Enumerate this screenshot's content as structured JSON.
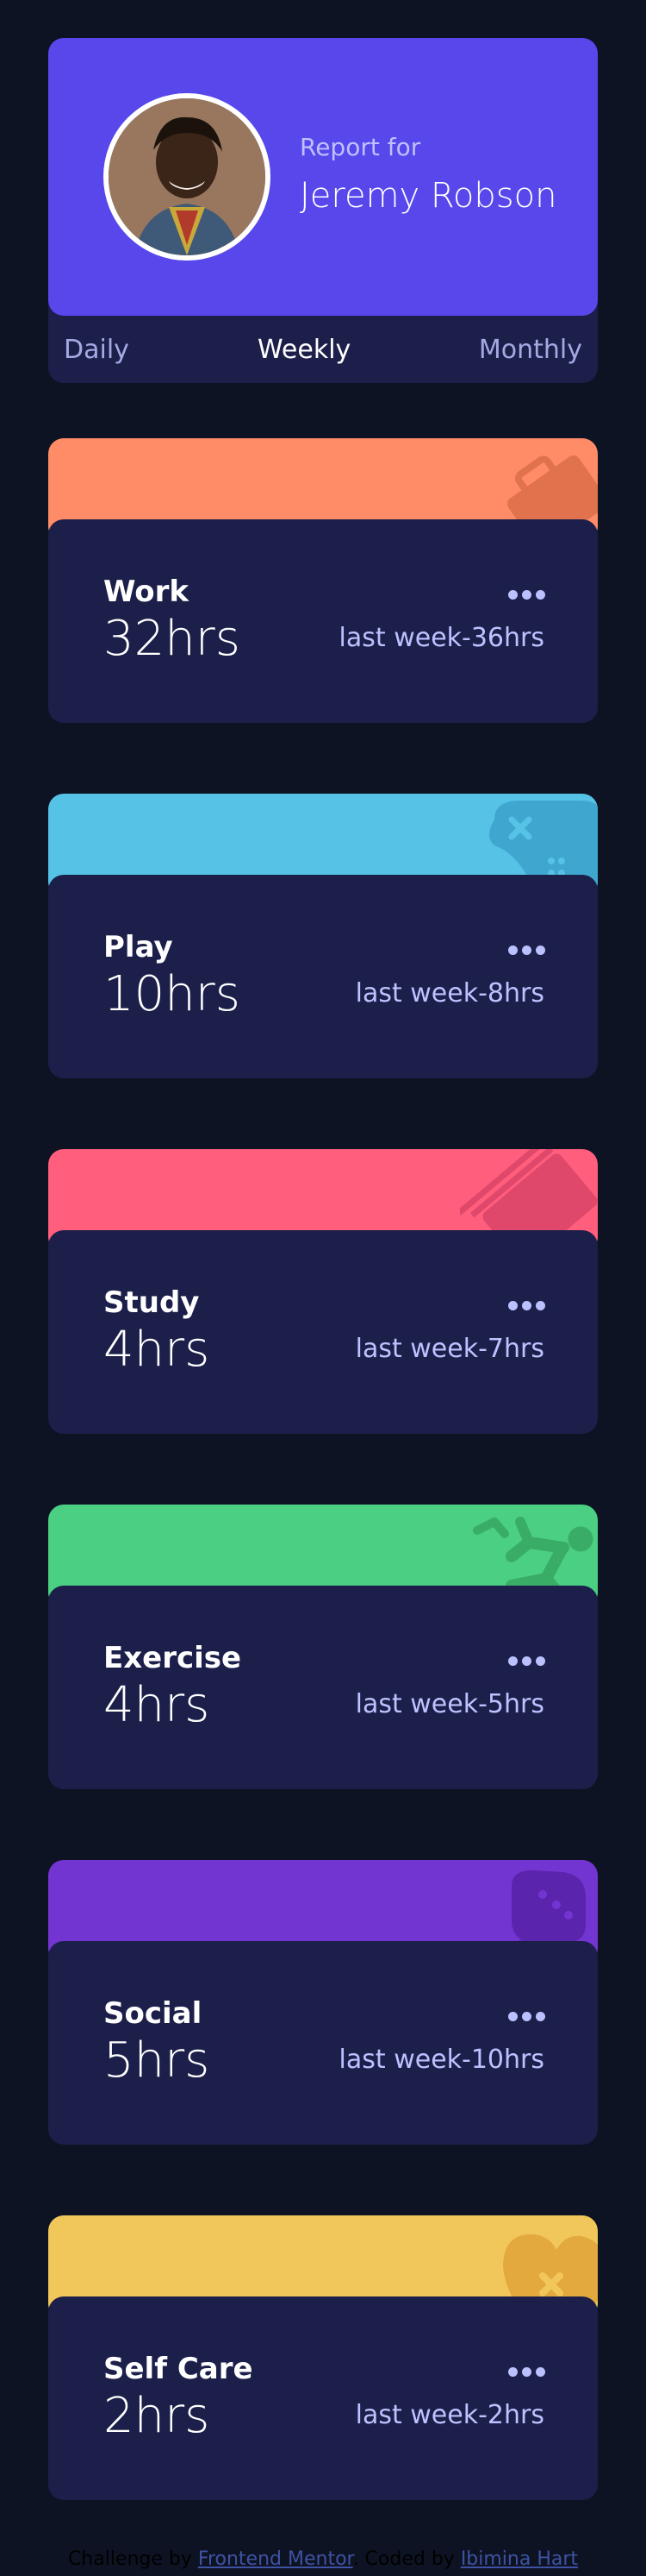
{
  "profile": {
    "report_label": "Report for",
    "name": "Jeremy Robson"
  },
  "tabs": [
    {
      "label": "Daily",
      "active": false
    },
    {
      "label": "Weekly",
      "active": true
    },
    {
      "label": "Monthly",
      "active": false
    }
  ],
  "colors": {
    "background": "#0e1323",
    "card": "#1c1f4a",
    "profile_accent": "#5847eb",
    "muted_text": "#bdc1ff"
  },
  "cards": [
    {
      "title": "Work",
      "hours": "32hrs",
      "previous": "last week-36hrs",
      "color": "#ff8c66",
      "icon": "briefcase-icon"
    },
    {
      "title": "Play",
      "hours": "10hrs",
      "previous": "last week-8hrs",
      "color": "#56c2e6",
      "icon": "gamepad-icon"
    },
    {
      "title": "Study",
      "hours": "4hrs",
      "previous": "last week-7hrs",
      "color": "#ff5e7d",
      "icon": "books-icon"
    },
    {
      "title": "Exercise",
      "hours": "4hrs",
      "previous": "last week-5hrs",
      "color": "#4bcf83",
      "icon": "runner-icon"
    },
    {
      "title": "Social",
      "hours": "5hrs",
      "previous": "last week-10hrs",
      "color": "#7335d2",
      "icon": "chat-icon"
    },
    {
      "title": "Self Care",
      "hours": "2hrs",
      "previous": "last week-2hrs",
      "color": "#f1c75b",
      "icon": "heart-cross-icon"
    }
  ],
  "footer": {
    "prefix": "Challenge by",
    "link1": "Frontend Mentor",
    "middle": ". Coded by",
    "link2": "Ibimina Hart"
  }
}
